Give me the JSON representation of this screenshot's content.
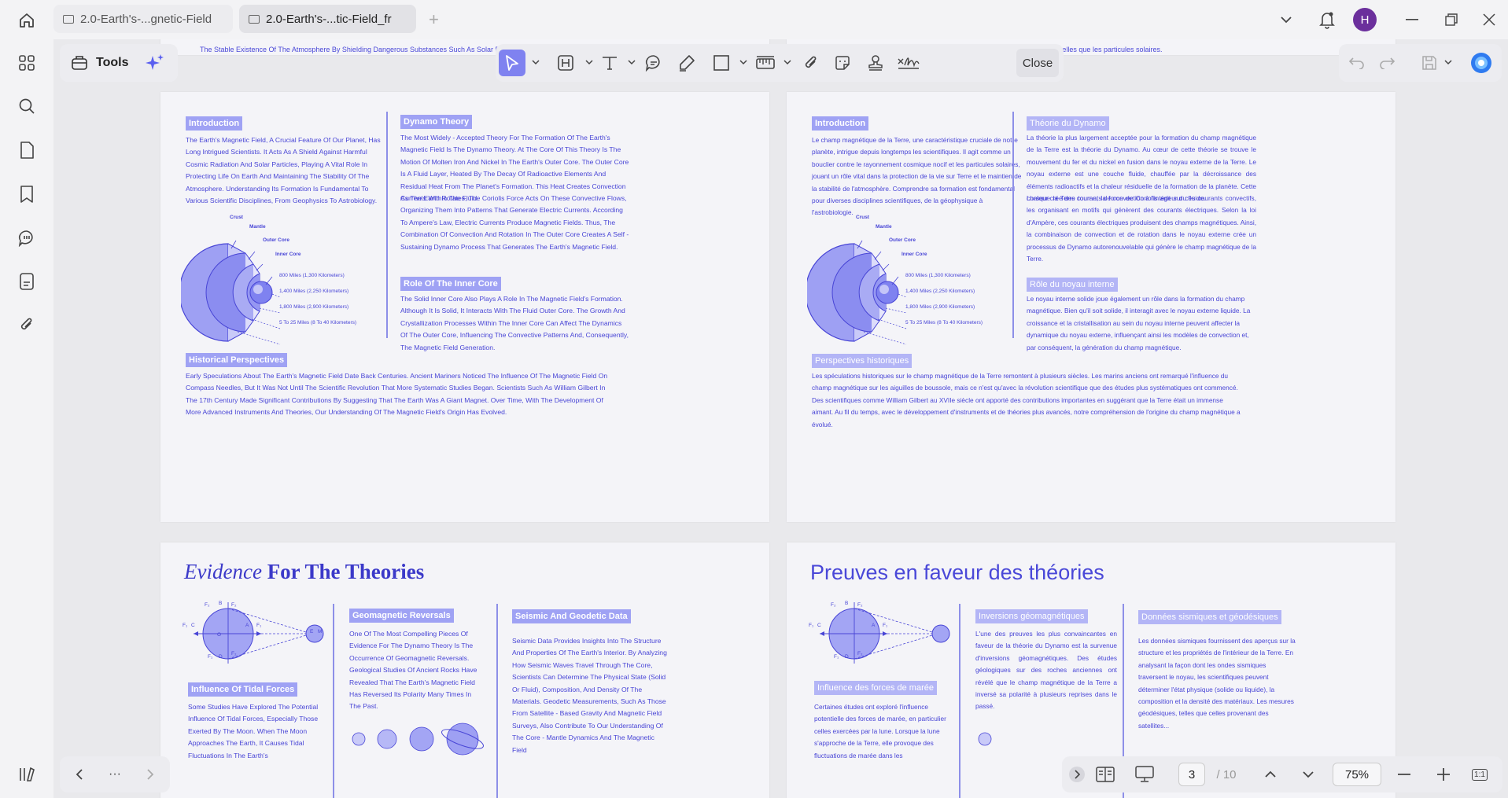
{
  "tabs": [
    {
      "label": "2.0-Earth's-...gnetic-Field"
    },
    {
      "label": "2.0-Earth's-...tic-Field_fr"
    }
  ],
  "new_tab_glyph": "+",
  "user_initial": "H",
  "toolbar": {
    "tools_label": "Tools",
    "close_label": "Close"
  },
  "icons": [
    "home-icon",
    "tab-document-icon",
    "chevron-down-icon",
    "bell-icon",
    "minimize-icon",
    "restore-icon",
    "close-window-icon",
    "apps-icon",
    "search-icon",
    "page-icon",
    "bookmark-icon",
    "comment-icon",
    "form-icon",
    "attachment-icon",
    "toolbox-icon",
    "sparkle-icon",
    "cursor-icon",
    "heading-icon",
    "text-icon",
    "comment-bubble-icon",
    "highlighter-icon",
    "rectangle-icon",
    "ruler-icon",
    "paperclip-icon",
    "sticker-icon",
    "stamp-icon",
    "signature-icon",
    "undo-icon",
    "redo-icon",
    "save-icon",
    "ai-assistant-icon",
    "sidebar-library-icon",
    "prev-page-icon",
    "more-icon",
    "next-page-icon",
    "expand-icon",
    "two-page-view-icon",
    "presentation-icon",
    "page-up-icon",
    "page-down-icon",
    "zoom-out-icon",
    "zoom-in-icon",
    "fit-icon"
  ],
  "navigation": {
    "current_page": "3",
    "total_pages": "/ 10",
    "zoom": "75%",
    "more": "···",
    "fit_label": "1:1"
  },
  "strip": {
    "en": "The Stable Existence Of The Atmosphere By Shielding Dangerous Substances Such As Solar Particles.",
    "fr": "stable de l'atmosphère en protégeant contre des substances dangereuses telles que les particules solaires."
  },
  "page_en_1": {
    "intro_heading": "Introduction",
    "intro_text": "The Earth's Magnetic Field, A Crucial Feature Of Our Planet, Has Long Intrigued Scientists. It Acts As A Shield Against Harmful Cosmic Radiation And Solar Particles, Playing A Vital Role In Protecting Life On Earth And Maintaining The Stability Of The Atmosphere. Understanding Its Formation Is Fundamental To Various Scientific Disciplines, From Geophysics To Astrobiology.",
    "fig_labels": [
      "Crust",
      "Mantle",
      "Outer Core",
      "Inner Core"
    ],
    "fig_dims": [
      "800 Miles (1,300 Kilometers)",
      "1,400 Miles (2,250 Kilometers)",
      "1,800 Miles (2,900 Kilometers)",
      "5 To 25 Miles (8 To 40 Kilometers)"
    ],
    "dynamo_heading": "Dynamo Theory",
    "dynamo_text": "The Most Widely - Accepted Theory For The Formation Of The Earth's Magnetic Field Is The Dynamo Theory. At The Core Of This Theory Is The Motion Of Molten Iron And Nickel In The Earth's Outer Core. The Outer Core Is A Fluid Layer, Heated By The Decay Of Radioactive Elements And Residual Heat From The Planet's Formation. This Heat Creates Convection Currents Within The Fluid.",
    "dynamo_text2": "As The Earth Rotates, The Coriolis Force Acts On These Convective Flows, Organizing Them Into Patterns That Generate Electric Currents. According To Ampere's Law, Electric Currents Produce Magnetic Fields. Thus, The Combination Of Convection And Rotation In The Outer Core Creates A Self - Sustaining Dynamo Process That Generates The Earth's Magnetic Field.",
    "inner_heading": "Role Of The Inner Core",
    "inner_text": "The Solid Inner Core Also Plays A Role In The Magnetic Field's Formation. Although It Is Solid, It Interacts With The Fluid Outer Core. The Growth And Crystallization Processes Within The Inner Core Can Affect The Dynamics Of The Outer Core, Influencing The Convective Patterns And, Consequently, The Magnetic Field Generation.",
    "hist_heading": "Historical Perspectives",
    "hist_text": "Early Speculations About The Earth's Magnetic Field Date Back Centuries. Ancient Mariners Noticed The Influence Of The Magnetic Field On Compass Needles, But It Was Not Until The Scientific Revolution That More Systematic Studies Began. Scientists Such As William Gilbert In The 17th Century Made Significant Contributions By Suggesting That The Earth Was A Giant Magnet. Over Time, With The Development Of More Advanced Instruments And Theories, Our Understanding Of The Magnetic Field's Origin Has Evolved."
  },
  "page_fr_1": {
    "intro_heading": "Introduction",
    "intro_text": "Le champ magnétique de la Terre, une caractéristique cruciale de notre planète, intrigue depuis longtemps les scientifiques. Il agit comme un bouclier contre le rayonnement cosmique nocif et les particules solaires, jouant un rôle vital dans la protection de la vie sur Terre et le maintien de la stabilité de l'atmosphère. Comprendre sa formation est fondamental pour diverses disciplines scientifiques, de la géophysique à l'astrobiologie.",
    "dynamo_heading": "Théorie du Dynamo",
    "dynamo_text": "La théorie la plus largement acceptée pour la formation du champ magnétique de la Terre est la théorie du Dynamo. Au cœur de cette théorie se trouve le mouvement du fer et du nickel en fusion dans le noyau externe de la Terre. Le noyau externe est une couche fluide, chauffée par la décroissance des éléments radioactifs et la chaleur résiduelle de la formation de la planète. Cette chaleur crée des courants de convection à l'intérieur du fluide.",
    "dynamo_text2": "Lorsque la Terre tourne, la force de Coriolis agit sur ces courants convectifs, les organisant en motifs qui génèrent des courants électriques. Selon la loi d'Ampère, ces courants électriques produisent des champs magnétiques. Ainsi, la combinaison de convection et de rotation dans le noyau externe crée un processus de Dynamo autorenouvelable qui génère le champ magnétique de la Terre.",
    "inner_heading": "Rôle du noyau interne",
    "inner_text": "Le noyau interne solide joue également un rôle dans la formation du champ magnétique. Bien qu'il soit solide, il interagit avec le noyau externe liquide. La croissance et la cristallisation au sein du noyau interne peuvent affecter la dynamique du noyau externe, influençant ainsi les modèles de convection et, par conséquent, la génération du champ magnétique.",
    "hist_heading": "Perspectives historiques",
    "hist_text": "Les spéculations historiques sur le champ magnétique de la Terre remontent à plusieurs siècles. Les marins anciens ont remarqué l'influence du champ magnétique sur les aiguilles de boussole, mais ce n'est qu'avec la révolution scientifique que des études plus systématiques ont commencé. Des scientifiques comme William Gilbert au XVIIe siècle ont apporté des contributions importantes en suggérant que la Terre était un immense aimant. Au fil du temps, avec le développement d'instruments et de théories plus avancés, notre compréhension de l'origine du champ magnétique a évolué."
  },
  "page_en_2": {
    "title_italic": "Evidence",
    "title_bold": " For The Theories",
    "tidal_heading": "Influence Of Tidal Forces",
    "tidal_text": "Some Studies Have Explored The Potential Influence Of Tidal Forces, Especially Those Exerted By The Moon. When The Moon Approaches The Earth, It Causes Tidal Fluctuations In The Earth's",
    "geo_heading": "Geomagnetic Reversals",
    "geo_text": "One Of The Most Compelling Pieces Of Evidence For The Dynamo Theory Is The Occurrence Of Geomagnetic Reversals. Geological Studies Of Ancient Rocks Have Revealed That The Earth's Magnetic Field Has Reversed Its Polarity Many Times In The Past.",
    "seismic_heading": "Seismic And Geodetic Data",
    "seismic_text": "Seismic Data Provides Insights Into The Structure And Properties Of The Earth's Interior. By Analyzing How Seismic Waves Travel Through The Core, Scientists Can Determine The Physical State (Solid Or Fluid), Composition, And Density Of The Materials. Geodetic Measurements, Such As Those From Satellite - Based Gravity And Magnetic Field Surveys, Also Contribute To Our Understanding Of The Core - Mantle Dynamics And The Magnetic Field"
  },
  "page_fr_2": {
    "title": "Preuves en faveur des théories",
    "tidal_heading": "Influence des forces de marée",
    "tidal_text": "Certaines études ont exploré l'influence potentielle des forces de marée, en particulier celles exercées par la lune. Lorsque la lune s'approche de la Terre, elle provoque des fluctuations de marée dans les",
    "geo_heading": "Inversions géomagnétiques",
    "geo_text": "L'une des preuves les plus convaincantes en faveur de la théorie du Dynamo est la survenue d'inversions géomagnétiques. Des études géologiques sur des roches anciennes ont révélé que le champ magnétique de la Terre a inversé sa polarité à plusieurs reprises dans le passé.",
    "seismic_heading": "Données sismiques et géodésiques",
    "seismic_text": "Les données sismiques fournissent des aperçus sur la structure et les propriétés de l'intérieur de la Terre. En analysant la façon dont les ondes sismiques traversent le noyau, les scientifiques peuvent déterminer l'état physique (solide ou liquide), la composition et la densité des matériaux. Les mesures géodésiques, telles que celles provenant des satellites..."
  },
  "tidal_fig_labels": [
    "F₂",
    "B",
    "F₂",
    "F₁",
    "C",
    "F₁",
    "F₁",
    "A",
    "F₁",
    "F₁",
    "F₂",
    "O",
    "F₁",
    "F₂",
    "D",
    "F₂",
    "E",
    "M"
  ],
  "colors": {
    "accent": "#4845d6",
    "tag": "#9fa2f4",
    "active_tool": "#7f82f0",
    "avatar": "#6b2f9c"
  }
}
